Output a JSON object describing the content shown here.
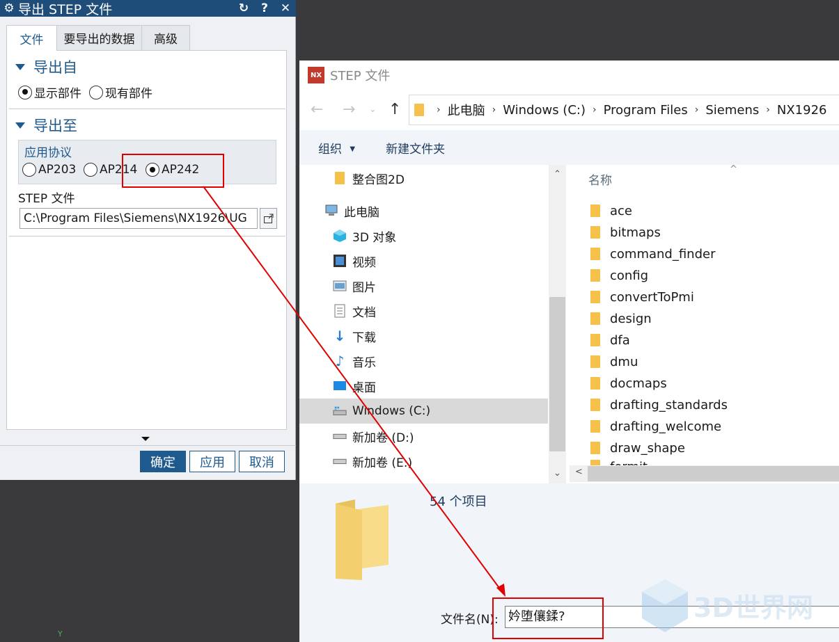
{
  "nx_dialog": {
    "title": "导出 STEP 文件",
    "tabs": [
      "文件",
      "要导出的数据",
      "高级"
    ],
    "section_export_from": "导出自",
    "opt_display_part": "显示部件",
    "opt_existing_part": "现有部件",
    "section_export_to": "导出至",
    "protocol_label": "应用协议",
    "protocols": [
      "AP203",
      "AP214",
      "AP242"
    ],
    "selected_protocol": "AP242",
    "step_file_label": "STEP 文件",
    "step_file_value": "C:\\Program Files\\Siemens\\NX1926\\UG",
    "btn_ok": "确定",
    "btn_apply": "应用",
    "btn_cancel": "取消"
  },
  "file_dialog": {
    "title": "STEP 文件",
    "logo": "NX",
    "breadcrumb": [
      "此电脑",
      "Windows (C:)",
      "Program Files",
      "Siemens",
      "NX1926"
    ],
    "organize": "组织",
    "new_folder": "新建文件夹",
    "nav_items": [
      {
        "label": "整合图2D",
        "icon": "folder-icon"
      },
      {
        "label": "此电脑",
        "icon": "computer-icon"
      },
      {
        "label": "3D 对象",
        "icon": "3d-objects-icon"
      },
      {
        "label": "视频",
        "icon": "video-icon"
      },
      {
        "label": "图片",
        "icon": "pictures-icon"
      },
      {
        "label": "文档",
        "icon": "documents-icon"
      },
      {
        "label": "下载",
        "icon": "download-icon"
      },
      {
        "label": "音乐",
        "icon": "music-icon"
      },
      {
        "label": "桌面",
        "icon": "desktop-icon"
      },
      {
        "label": "Windows (C:)",
        "icon": "drive-icon"
      },
      {
        "label": "新加卷 (D:)",
        "icon": "drive-icon"
      },
      {
        "label": "新加卷 (E:)",
        "icon": "drive-icon"
      }
    ],
    "column_name": "名称",
    "files": [
      "ace",
      "bitmaps",
      "command_finder",
      "config",
      "convertToPmi",
      "design",
      "dfa",
      "dmu",
      "docmaps",
      "drafting_standards",
      "drafting_welcome",
      "draw_shape",
      "formit"
    ],
    "item_count": "54 个项目",
    "filename_label": "文件名(N):",
    "filename_value": "妗堕儴鍒?"
  },
  "viewport": {
    "axis_label": "Y"
  },
  "watermark": "3D世界网",
  "colors": {
    "nx_title_bg": "#1f4d7a",
    "nx_accent": "#1f5a8e",
    "annotation_red": "#e00000",
    "folder_yellow": "#f5c14a",
    "selected_nav_bg": "#d9d9d9"
  }
}
